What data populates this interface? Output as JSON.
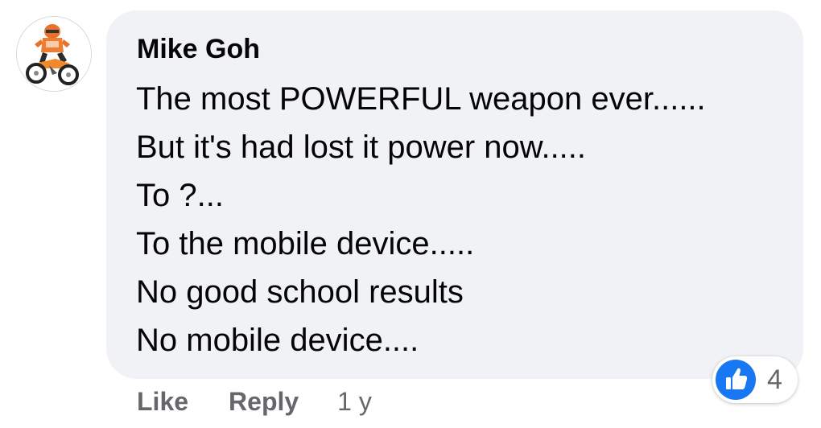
{
  "comment": {
    "author": "Mike Goh",
    "lines": [
      "The most POWERFUL weapon ever......",
      "But it's had lost it power now.....",
      "To ?...",
      "To the mobile device.....",
      "No good school results",
      "No mobile device...."
    ],
    "avatar_icon": "motorbike-rider-avatar"
  },
  "reactions": {
    "icon": "thumbs-up-icon",
    "count": "4",
    "badge_color": "#1877f2"
  },
  "actions": {
    "like_label": "Like",
    "reply_label": "Reply",
    "timestamp": "1 y"
  },
  "colors": {
    "bubble_bg": "#f0f2f5",
    "text": "#050505",
    "secondary_text": "#65676b"
  }
}
